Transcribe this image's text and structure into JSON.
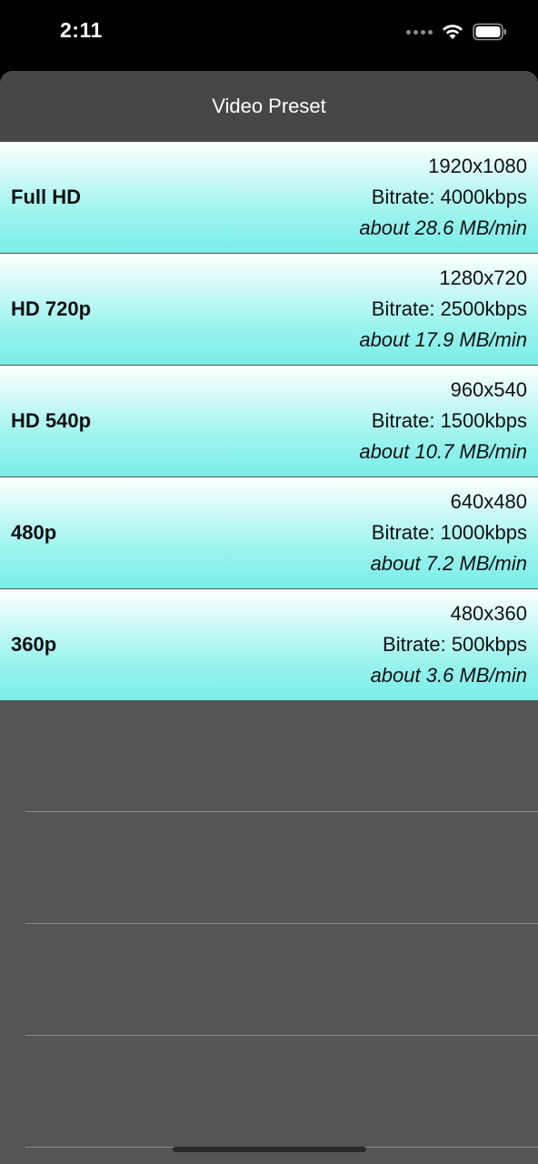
{
  "status_bar": {
    "time": "2:11"
  },
  "header": {
    "title": "Video Preset"
  },
  "presets": [
    {
      "name": "Full HD",
      "resolution": "1920x1080",
      "bitrate": "Bitrate: 4000kbps",
      "size": "about 28.6 MB/min"
    },
    {
      "name": "HD 720p",
      "resolution": "1280x720",
      "bitrate": "Bitrate: 2500kbps",
      "size": "about 17.9 MB/min"
    },
    {
      "name": "HD 540p",
      "resolution": "960x540",
      "bitrate": "Bitrate: 1500kbps",
      "size": "about 10.7 MB/min"
    },
    {
      "name": "480p",
      "resolution": "640x480",
      "bitrate": "Bitrate: 1000kbps",
      "size": "about 7.2 MB/min"
    },
    {
      "name": "360p",
      "resolution": "480x360",
      "bitrate": "Bitrate: 500kbps",
      "size": "about 3.6 MB/min"
    }
  ],
  "colors": {
    "row_gradient_top": "#ffffff",
    "row_gradient_bottom": "#7aede8",
    "sheet_background": "#555555",
    "header_background": "#474747"
  }
}
